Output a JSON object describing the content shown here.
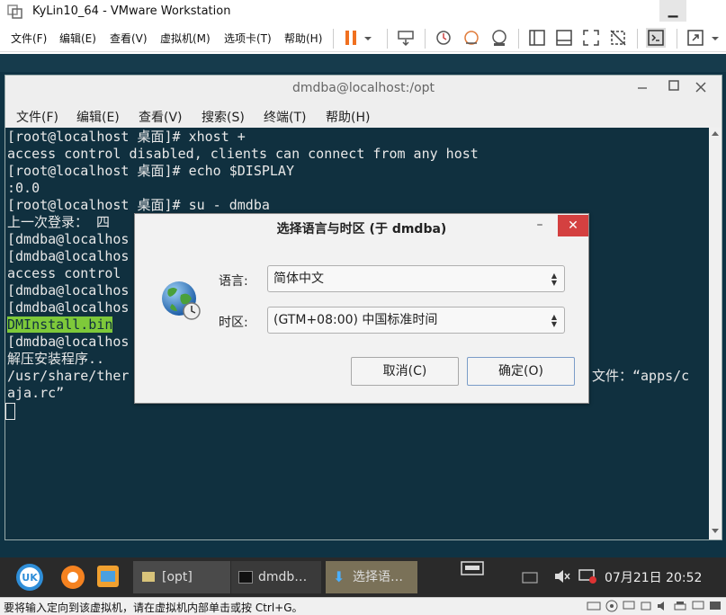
{
  "vmware": {
    "title": "KyLin10_64 - VMware Workstation",
    "menu": [
      "文件(F)",
      "编辑(E)",
      "查看(V)",
      "虚拟机(M)",
      "选项卡(T)",
      "帮助(H)"
    ],
    "status_text": "要将输入定向到该虚拟机，请在虚拟机内部单击或按 Ctrl+G。"
  },
  "terminal": {
    "title": "dmdba@localhost:/opt",
    "menu": [
      "文件(F)",
      "编辑(E)",
      "查看(V)",
      "搜索(S)",
      "终端(T)",
      "帮助(H)"
    ],
    "lines": [
      "[root@localhost 桌面]# xhost +",
      "access control disabled, clients can connect from any host",
      "[root@localhost 桌面]# echo $DISPLAY",
      ":0.0",
      "[root@localhost 桌面]# su - dmdba",
      "上一次登录： 四",
      "[dmdba@localhos",
      "[dmdba@localhos",
      "access control",
      "[dmdba@localhos",
      "[dmdba@localhos",
      "DMInstall.bin",
      "[dmdba@localhos",
      "解压安装程序..",
      "/usr/share/ther",
      "aja.rc”"
    ],
    "line_right": "文件：“apps/c"
  },
  "dialog": {
    "title": "选择语言与时区 (于 dmdba)",
    "language_label": "语言:",
    "language_value": "简体中文",
    "timezone_label": "时区:",
    "timezone_value": "(GTM+08:00) 中国标准时间",
    "cancel_label": "取消(C)",
    "ok_label": "确定(O)"
  },
  "taskbar": {
    "items": [
      "[opt]",
      "dmdb…",
      "选择语…"
    ],
    "datetime": "07月21日 20:52"
  },
  "colors": {
    "terminal_bg": "#10303f",
    "highlight": "#7ec93a",
    "close_red": "#d44040"
  }
}
